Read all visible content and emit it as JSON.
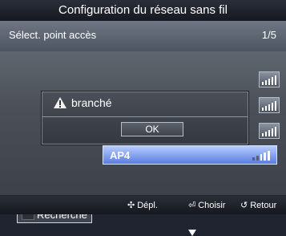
{
  "header": {
    "title": "Configuration du réseau sans fil"
  },
  "subheader": {
    "title": "Sélect. point accès",
    "page": "1/5"
  },
  "access_points": [
    {
      "label": "AP4",
      "selected": true
    }
  ],
  "dialog": {
    "message": "branché",
    "ok_label": "OK"
  },
  "buttons": {
    "search_label": "Recherche"
  },
  "footer": {
    "move_label": "Dépl.",
    "enter_label": "Choisir",
    "return_label": "Retour"
  },
  "icons": {
    "warning": "warning-icon",
    "move": "dpad-icon",
    "enter": "enter-icon",
    "return": "return-icon",
    "signal": "signal-strength-icon"
  }
}
